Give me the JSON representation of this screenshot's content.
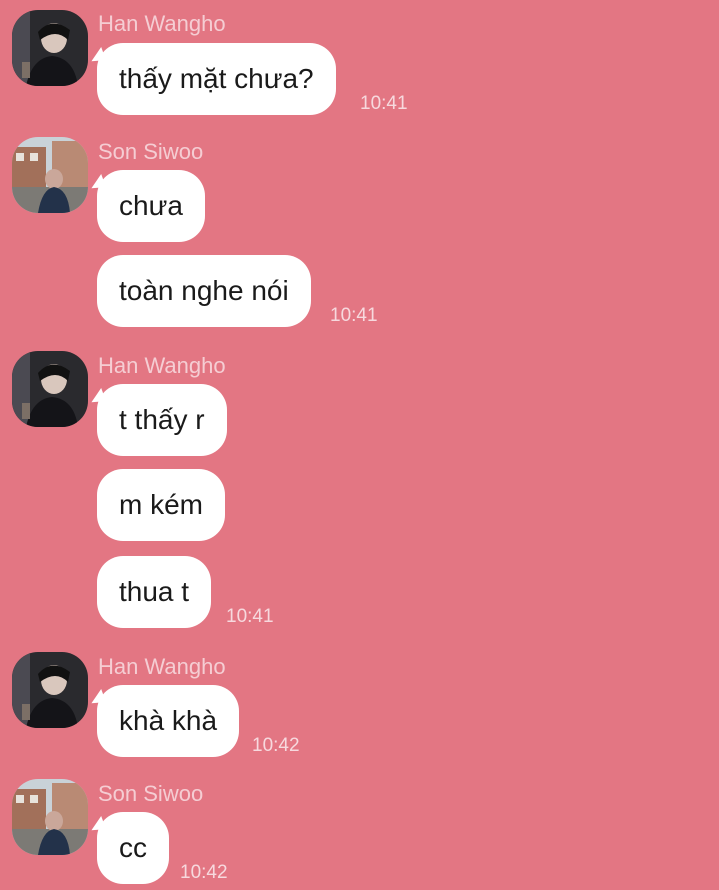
{
  "groups": [
    {
      "sender": "Han Wangho",
      "avatar": "han-wangho-avatar",
      "messages": [
        "thấy mặt chưa?"
      ],
      "time": "10:41"
    },
    {
      "sender": "Son Siwoo",
      "avatar": "son-siwoo-avatar",
      "messages": [
        "chưa",
        "toàn nghe nói"
      ],
      "time": "10:41"
    },
    {
      "sender": "Han Wangho",
      "avatar": "han-wangho-avatar",
      "messages": [
        "t thấy r",
        "m kém",
        "thua t"
      ],
      "time": "10:41"
    },
    {
      "sender": "Han Wangho",
      "avatar": "han-wangho-avatar",
      "messages": [
        "khà khà"
      ],
      "time": "10:42"
    },
    {
      "sender": "Son Siwoo",
      "avatar": "son-siwoo-avatar",
      "messages": [
        "cc"
      ],
      "time": "10:42"
    }
  ],
  "colors": {
    "background": "#e37683",
    "bubble": "#ffffff",
    "meta_text": "#f5cdd3"
  }
}
